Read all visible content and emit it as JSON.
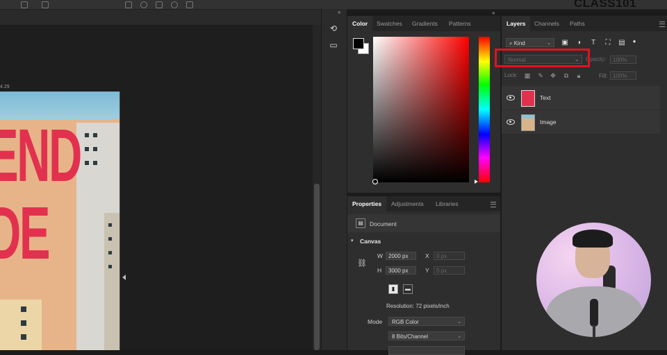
{
  "brand": {
    "logo_text": "CLASS101"
  },
  "canvas": {
    "artboard_label": "4.29",
    "poster_text": "END\nDE"
  },
  "color_panel": {
    "tabs": [
      "Color",
      "Swatches",
      "Gradients",
      "Patterns"
    ],
    "active_tab": "Color",
    "foreground": "#000000",
    "background": "#ffffff",
    "hue": "#ff0000"
  },
  "properties_panel": {
    "tabs": [
      "Properties",
      "Adjustments",
      "Libraries"
    ],
    "active_tab": "Properties",
    "document_label": "Document",
    "canvas_section": "Canvas",
    "width_label": "W",
    "width_value": "2000 px",
    "height_label": "H",
    "height_value": "3000 px",
    "x_label": "X",
    "x_placeholder": "0 px",
    "y_label": "Y",
    "y_placeholder": "0 px",
    "resolution": "Resolution: 72 pixels/inch",
    "mode_label": "Mode",
    "mode_value": "RGB Color",
    "bits_value": "8 Bits/Channel"
  },
  "layers_panel": {
    "tabs": [
      "Layers",
      "Channels",
      "Paths"
    ],
    "active_tab": "Layers",
    "filter_kind": "Kind",
    "blend_mode": "Normal",
    "opacity_label": "Opacity:",
    "opacity_value": "100%",
    "lock_label": "Lock:",
    "fill_label": "Fill:",
    "fill_value": "100%",
    "layers": [
      {
        "name": "Text",
        "visible": true
      },
      {
        "name": "Image",
        "visible": true
      }
    ]
  },
  "colors": {
    "accent_highlight": "#e3121f",
    "poster_red": "#e2314e"
  }
}
